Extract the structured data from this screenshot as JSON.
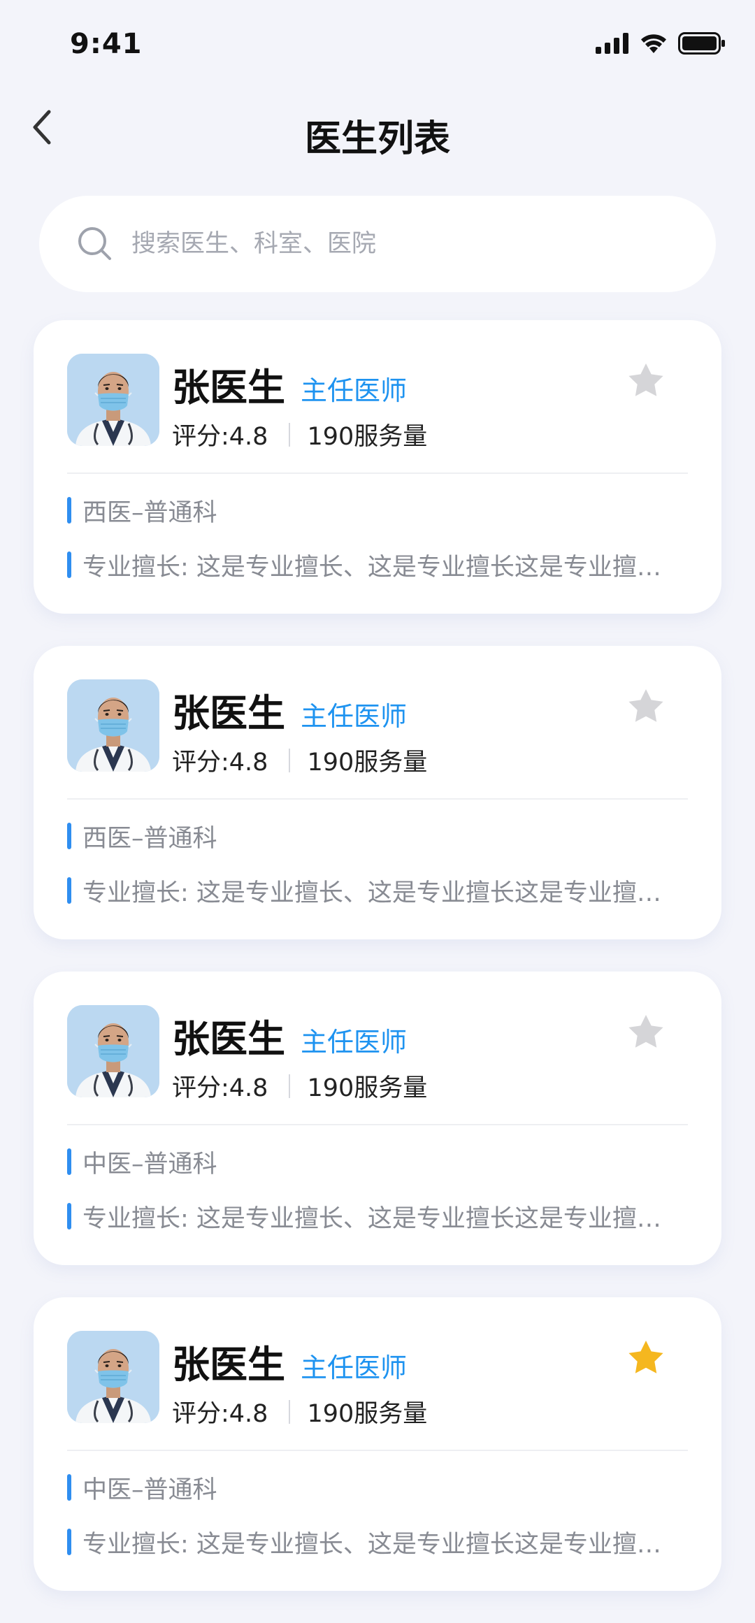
{
  "status_bar": {
    "time": "9:41",
    "icons": [
      "signal-icon",
      "wifi-icon",
      "battery-icon"
    ]
  },
  "header": {
    "title": "医生列表",
    "back_icon": "chevron-left-icon"
  },
  "search": {
    "placeholder": "搜索医生、科室、医院",
    "value": "",
    "icon": "search-icon"
  },
  "colors": {
    "background": "#F3F4FA",
    "accent": "#1E93F0",
    "marker_bar": "#2F8EF0",
    "star_inactive": "#D5D5D8",
    "star_active": "#F5B71F"
  },
  "doctors": [
    {
      "name": "张医生",
      "title": "主任医师",
      "rating": "评分:4.8",
      "service": "190服务量",
      "department": "西医–普通科",
      "expertise": "专业擅长: 这是专业擅长、这是专业擅长这是专业擅长这是专业擅长",
      "favorite": false
    },
    {
      "name": "张医生",
      "title": "主任医师",
      "rating": "评分:4.8",
      "service": "190服务量",
      "department": "西医–普通科",
      "expertise": "专业擅长: 这是专业擅长、这是专业擅长这是专业擅长这是专业擅长",
      "favorite": false
    },
    {
      "name": "张医生",
      "title": "主任医师",
      "rating": "评分:4.8",
      "service": "190服务量",
      "department": "中医–普通科",
      "expertise": "专业擅长: 这是专业擅长、这是专业擅长这是专业擅长这是专业擅长",
      "favorite": false
    },
    {
      "name": "张医生",
      "title": "主任医师",
      "rating": "评分:4.8",
      "service": "190服务量",
      "department": "中医–普通科",
      "expertise": "专业擅长: 这是专业擅长、这是专业擅长这是专业擅长这是专业擅长",
      "favorite": true
    }
  ]
}
